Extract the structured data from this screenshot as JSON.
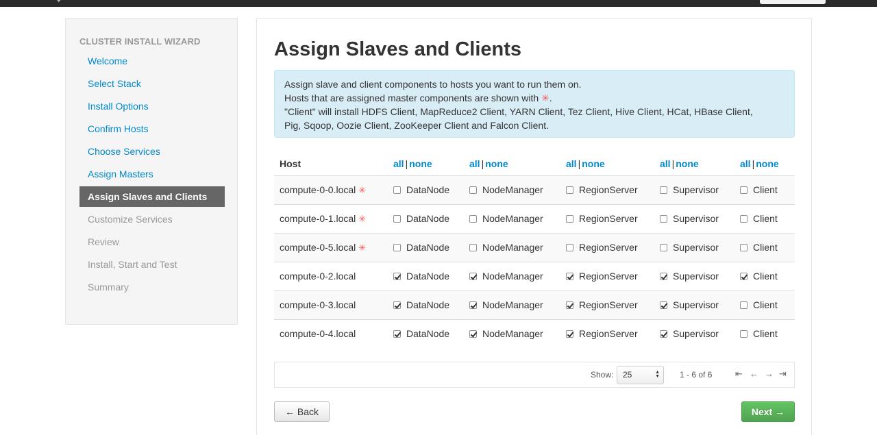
{
  "topbar": {
    "logo_icon": "ambari-logo-icon"
  },
  "sidebar": {
    "title": "CLUSTER INSTALL WIZARD",
    "items": [
      {
        "label": "Welcome",
        "state": "done"
      },
      {
        "label": "Select Stack",
        "state": "done"
      },
      {
        "label": "Install Options",
        "state": "done"
      },
      {
        "label": "Confirm Hosts",
        "state": "done"
      },
      {
        "label": "Choose Services",
        "state": "done"
      },
      {
        "label": "Assign Masters",
        "state": "done"
      },
      {
        "label": "Assign Slaves and Clients",
        "state": "active"
      },
      {
        "label": "Customize Services",
        "state": "todo"
      },
      {
        "label": "Review",
        "state": "todo"
      },
      {
        "label": "Install, Start and Test",
        "state": "todo"
      },
      {
        "label": "Summary",
        "state": "todo"
      }
    ]
  },
  "main": {
    "title": "Assign Slaves and Clients",
    "info": {
      "line1": "Assign slave and client components to hosts you want to run them on.",
      "line2_prefix": "Hosts that are assigned master components are shown with",
      "line2_star": "✳",
      "line2_suffix": ".",
      "line3": "\"Client\" will install HDFS Client, MapReduce2 Client, YARN Client, Tez Client, Hive Client, HCat, HBase Client,",
      "line4": "Pig, Sqoop, Oozie Client, ZooKeeper Client and Falcon Client."
    },
    "table": {
      "host_header": "Host",
      "all_label": "all",
      "sep_label": "|",
      "none_label": "none",
      "star_glyph": "✳",
      "components": [
        "DataNode",
        "NodeManager",
        "RegionServer",
        "Supervisor",
        "Client"
      ],
      "rows": [
        {
          "host": "compute-0-0.local",
          "master": true,
          "checked": [
            false,
            false,
            false,
            false,
            false
          ]
        },
        {
          "host": "compute-0-1.local",
          "master": true,
          "checked": [
            false,
            false,
            false,
            false,
            false
          ]
        },
        {
          "host": "compute-0-5.local",
          "master": true,
          "checked": [
            false,
            false,
            false,
            false,
            false
          ]
        },
        {
          "host": "compute-0-2.local",
          "master": false,
          "checked": [
            true,
            true,
            true,
            true,
            true
          ]
        },
        {
          "host": "compute-0-3.local",
          "master": false,
          "checked": [
            true,
            true,
            true,
            true,
            false
          ]
        },
        {
          "host": "compute-0-4.local",
          "master": false,
          "checked": [
            true,
            true,
            true,
            true,
            false
          ]
        }
      ]
    },
    "pager": {
      "show_label": "Show:",
      "page_size": "25",
      "range": "1 - 6 of 6",
      "first_glyph": "⇤",
      "prev_glyph": "←",
      "next_glyph": "→",
      "last_glyph": "⇥"
    },
    "back_label": "← Back",
    "next_label": "Next →"
  },
  "colors": {
    "link": "#0088cc",
    "active_step_bg": "#666666",
    "info_bg": "#d9edf7",
    "next_button": "#5bb75b",
    "master_star": "#ff4f4f"
  }
}
